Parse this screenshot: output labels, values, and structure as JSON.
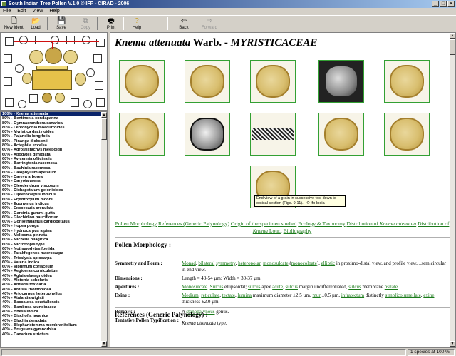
{
  "window": {
    "title": "South Indian Tree Pollen V.1.0 © IFP - CIRAD - 2006"
  },
  "menu": [
    "File",
    "Edit",
    "View",
    "Help"
  ],
  "toolbar": {
    "new": "New Ident.",
    "load": "Load",
    "save": "Save",
    "copy": "Copy",
    "print": "Print",
    "help": "Help",
    "back": "Back",
    "forward": "Forward"
  },
  "species_list": [
    "100% - Knema attenuata",
    "80% - Bentinckia condapanna",
    "80% - Gymnacranthera canarica",
    "80% - Leptonychia moacurroides",
    "80% - Myristica dactyloides",
    "80% - Pajanelia longifolia",
    "80% - Pinanga dicksonii",
    "80% - Actephila excelsa",
    "60% - Agrostistachys meeboldii",
    "60% - Apodytes dimidiata",
    "60% - Avicennia officinalis",
    "60% - Barringtonia racemosa",
    "60% - Bauhinia racemosa",
    "60% - Calophyllum apetalum",
    "60% - Careya arborea",
    "60% - Caryota urens",
    "60% - Cleodendrum viscosum",
    "60% - Dichapetalum gelonioides",
    "60% - Dipterocarpus indicus",
    "60% - Erythroxylum moonii",
    "60% - Euonymus indicus",
    "60% - Excoecaria crenulata",
    "60% - Garcinia gummi-gutta",
    "60% - Glochidion pauciflorum",
    "60% - Goniothalamus cardiopetalus",
    "60% - Hopea ponga",
    "60% - Hydnocarpus alpina",
    "60% - Meliosma pinnata",
    "60% - Michelia nilagirica",
    "60% - Microtropis type",
    "60% - Nothapodytes foetida",
    "60% - Tarakfogenos macrocarpa",
    "60% - Tricalysia apiocarpa",
    "60% - Vateria indica",
    "60% - Viburnum coriaceum",
    "40% - Aegiceras corniculatum",
    "40% - Aglaia elaeagnoidea",
    "40% - Alstonia scholaris",
    "40% - Antiaris toxicaria",
    "40% - Ardisia rhomboidea",
    "40% - Artocarpus heterophyllus",
    "40% - Atalantia wightii",
    "40% - Baccaurea courtallensis",
    "40% - Bambusa arundinacea",
    "40% - Bhesa indica",
    "40% - Bischofia javanica",
    "40% - Blachia denudata",
    "40% - Blepharistemma membranifolium",
    "40% - Bruguiera gymnorhiza",
    "40% - Canarium strictum"
  ],
  "species_title": {
    "genus_species": "Knema attenuata",
    "author": " Warb. - ",
    "family": "MYRISTICACEAE"
  },
  "tooltip": "End view of a grain in successive foci down to optical section (Figs. 9-11). - © Ifp India",
  "links": {
    "pollen_morphology": "Pollen Morphology",
    "references": "References (Generic Palynology)",
    "origin": "Origin of the specimen studied",
    "ecology": "Ecology & Taxonomy",
    "distribution_prefix": "Distribution of ",
    "distribution_name": "Knema attenuata",
    "distribution_of": "Distribution of ",
    "distribution_lour": "Knema",
    "distribution_lour_suffix": " Lour.",
    "bibliography": "Bibliography"
  },
  "section_pollen": "Pollen Morphology :",
  "section_references": "References (Generic Palynology) :",
  "morphology": {
    "symmetry_label": "Symmetry and Form :",
    "symmetry": {
      "monad": "Monad",
      "bilateral": "bilateral",
      "symmetry": "symmetry",
      "heteropolar": "heteropolar",
      "monosulcate": "monosulcate",
      "monocolpate": "monocolpate",
      "elliptic": "elliptic",
      "tail": " in proximo-distal view, and profile view, ±semicircular in end view."
    },
    "dimensions_label": "Dimensions :",
    "dimensions": "Length = 43-54 µm; Width = 30-37 µm.",
    "apertures_label": "Apertures :",
    "apertures": {
      "monosulcate": "Monosulcate",
      "sulcus1": "Sulcus",
      "t1": " ellipsoidal; ",
      "sulcus2": "sulcus",
      "t2": " apex ",
      "acute": "acute",
      "sulcus3": "sulcus",
      "t3": " margin undifferentiated, ",
      "sulcus4": "sulcus",
      "t4": " membrane ",
      "psilate": "psilate",
      "t5": "."
    },
    "exine_label": "Exine :",
    "exine": {
      "medium": "Medium",
      "reticulate": "reticulate",
      "tectate": "tectate",
      "lumina": "lumina",
      "t1": " maximum diameter ±2.5 µm, ",
      "mur": "mur",
      "t2": " ±0.5 µm, ",
      "infratectum": "infratectum",
      "t3": " distinctly ",
      "simplicolumellate": "simplicolumellate",
      "exine": "exine",
      "t4": " thickness ±2.0 µm."
    },
    "remark_label": "Remark :",
    "remark_a": "A ",
    "remark_link": "stenopalynous",
    "remark_b": " genus.",
    "tentative_label": "Tentative Pollen Typification :",
    "tentative_name": "Knema attenuata",
    "tentative_suffix": " type."
  },
  "status": {
    "species_count": "1 species at 100 %"
  }
}
